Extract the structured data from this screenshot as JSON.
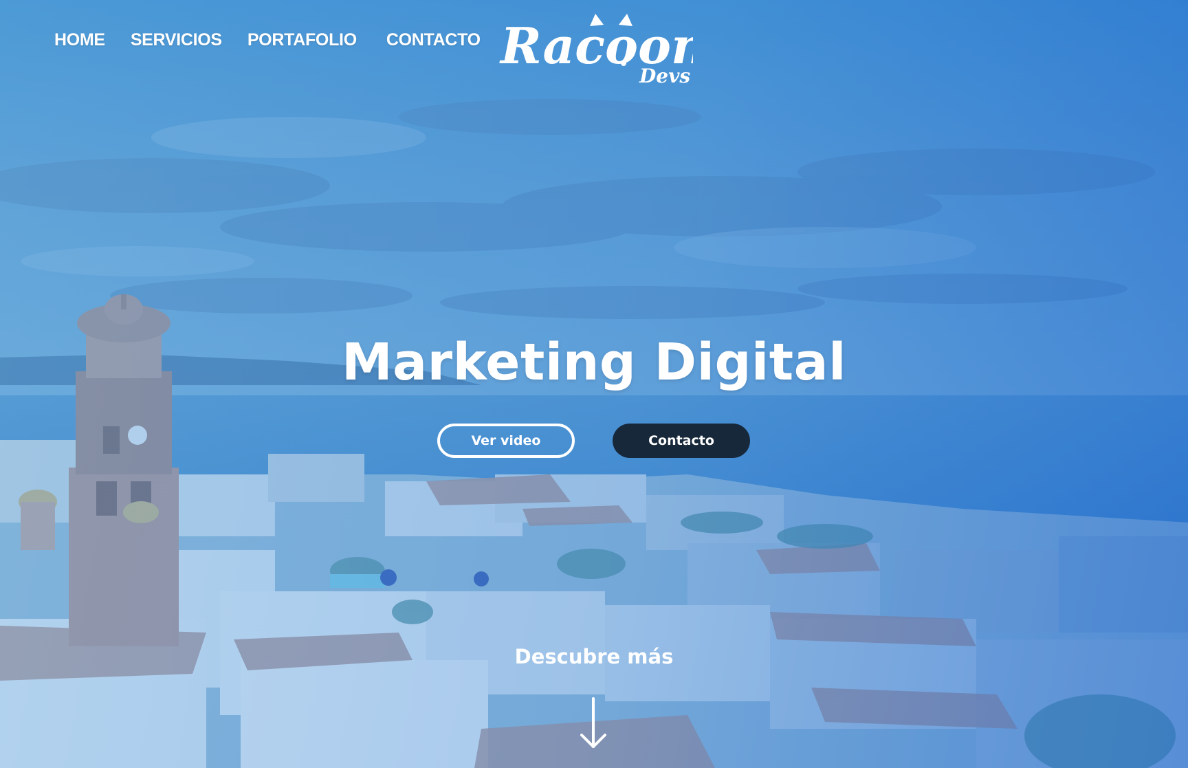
{
  "nav": {
    "items": [
      {
        "label": "HOME"
      },
      {
        "label": "SERVICIOS"
      },
      {
        "label": "PORTAFOLIO"
      },
      {
        "label": "CONTACTO"
      }
    ]
  },
  "logo": {
    "text": "Racoon",
    "subtext": "Devs"
  },
  "hero": {
    "title": "Marketing Digital",
    "buttons": {
      "video_label": "Ver video",
      "contact_label": "Contacto"
    },
    "discover_label": "Descubre más",
    "discover_icon": "arrow-down-icon"
  },
  "colors": {
    "overlay_blue": "#2f7fd4",
    "contact_button": "#17283a",
    "text": "#ffffff"
  }
}
